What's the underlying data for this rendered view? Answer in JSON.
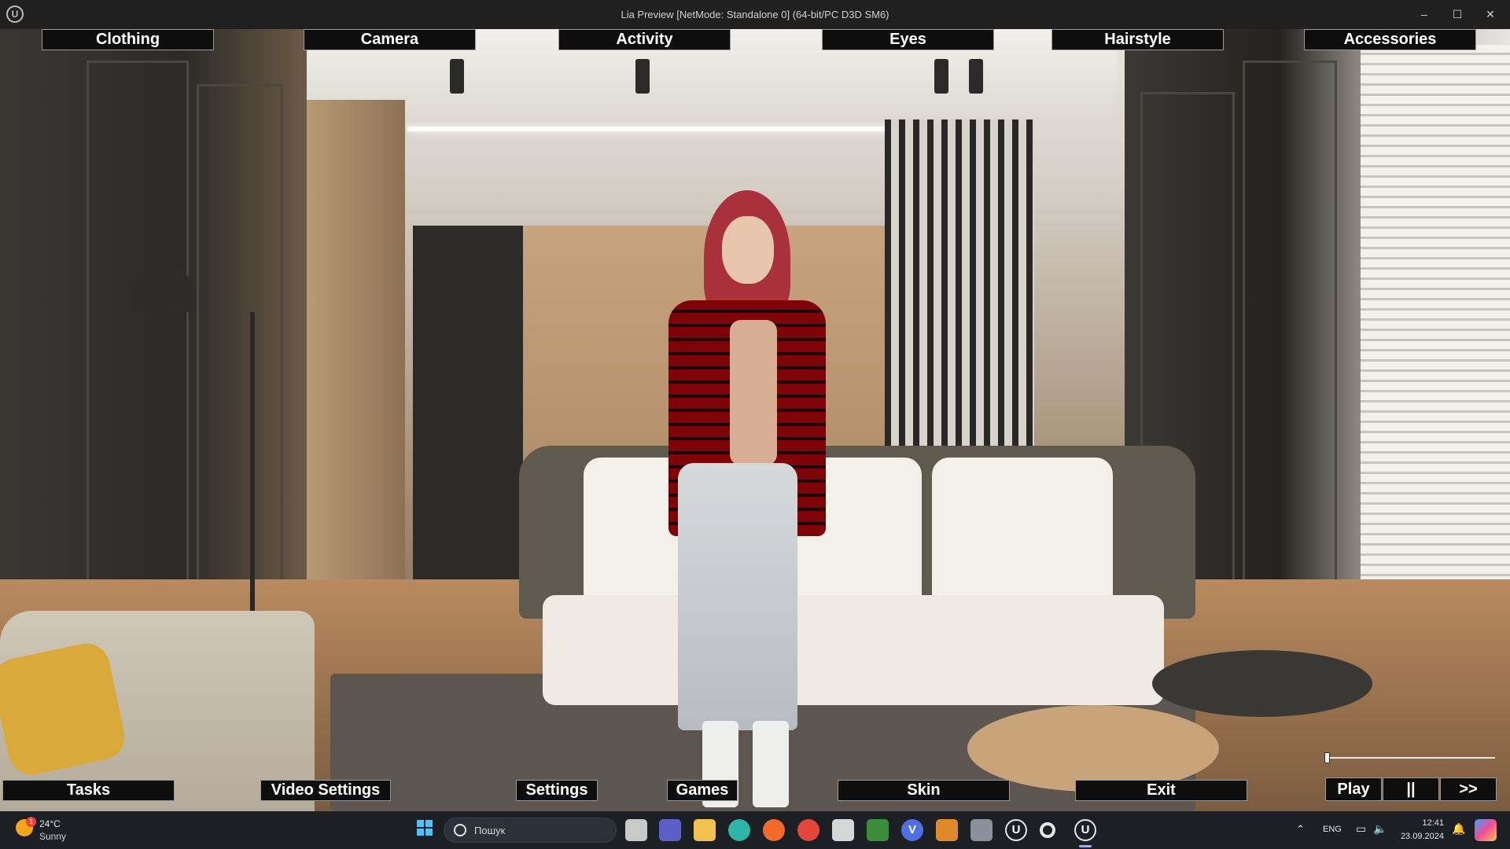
{
  "window": {
    "title": "Lia Preview [NetMode: Standalone 0]  (64-bit/PC D3D SM6)",
    "controls": {
      "minimize": "–",
      "maximize": "☐",
      "close": "✕"
    },
    "logo": "U"
  },
  "top_menu": {
    "clothing": "Clothing",
    "camera": "Camera",
    "activity": "Activity",
    "eyes": "Eyes",
    "hairstyle": "Hairstyle",
    "accessories": "Accessories"
  },
  "bottom_menu": {
    "tasks": "Tasks",
    "video_settings": "Video Settings",
    "settings": "Settings",
    "games": "Games",
    "skin": "Skin",
    "exit": "Exit"
  },
  "playback": {
    "play": "Play",
    "pause": "||",
    "forward": ">>",
    "progress": 0.0
  },
  "taskbar": {
    "weather": {
      "temp": "24°C",
      "condition": "Sunny",
      "badge": "1"
    },
    "search_placeholder": "Пошук",
    "language": "ENG",
    "time": "12:41",
    "date": "23.09.2024"
  },
  "icons": {
    "start": "windows-start-icon",
    "ue_taskbar": "U",
    "v_app": "V"
  },
  "colors": {
    "button_bg": "#0e0e0e",
    "button_border": "#9a9a9a",
    "taskbar_bg": "#1c1f24",
    "titlebar_bg": "#202020"
  }
}
